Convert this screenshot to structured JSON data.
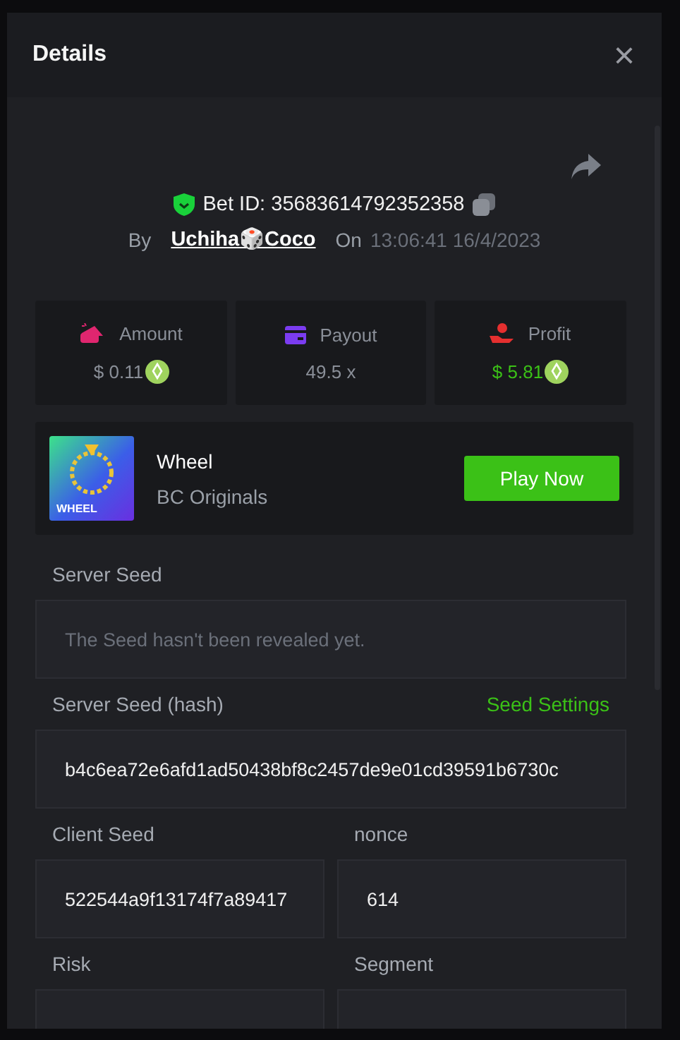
{
  "dialog": {
    "title": "Details",
    "close": "×"
  },
  "bet": {
    "verified": true,
    "id_label": "Bet ID:",
    "id": "35683614792352358",
    "by_label": "By",
    "user": "Uchiha🎲Coco",
    "on_label": "On",
    "time": "13:06:41 16/4/2023"
  },
  "stats": [
    {
      "kind": "amount",
      "label": "Amount",
      "value": "$ 0.11",
      "coin": true,
      "color": "#e0266f"
    },
    {
      "kind": "payout",
      "label": "Payout",
      "value": "49.5 x",
      "coin": false,
      "color": "#7b3cf0"
    },
    {
      "kind": "profit",
      "label": "Profit",
      "value": "$ 5.81",
      "coin": true,
      "color": "#e52f2f"
    }
  ],
  "game": {
    "name": "Wheel",
    "provider": "BC Originals",
    "thumb_label": "WHEEL",
    "button": "Play Now"
  },
  "fields": [
    {
      "label": "Server Seed",
      "placeholder": "The Seed hasn't been revealed yet.",
      "kind": "wide"
    },
    {
      "label": "Server Seed (hash)",
      "link": "Seed Settings",
      "value": "b4c6ea72e6afd1ad50438bf8c2457de9e01cd39591b6730c",
      "kind": "wide"
    },
    {
      "label": "Client Seed",
      "value": "522544a9f13174f7a89417",
      "kind": "narrow"
    },
    {
      "label": "nonce",
      "value": "614",
      "kind": "narrow"
    },
    {
      "label": "Risk",
      "kind": "narrow"
    },
    {
      "label": "Segment",
      "kind": "narrow"
    }
  ]
}
